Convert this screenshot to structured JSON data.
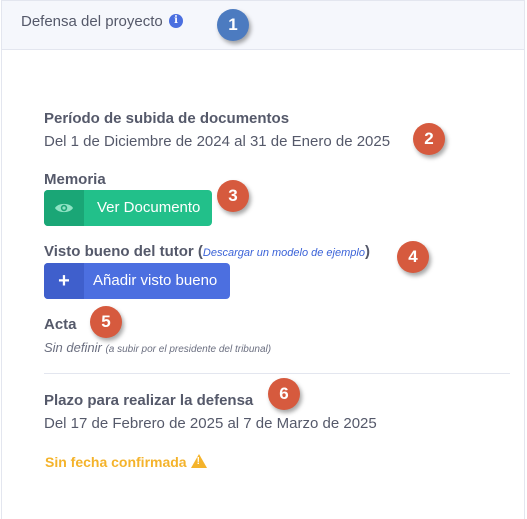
{
  "header": {
    "title": "Defensa del proyecto",
    "info_glyph": "i"
  },
  "badges": [
    "1",
    "2",
    "3",
    "4",
    "5",
    "6"
  ],
  "upload_period": {
    "label": "Período de subida de documentos",
    "value": "Del 1 de Diciembre de 2024 al 31 de Enero de 2025"
  },
  "memoria": {
    "label": "Memoria",
    "button_label": "Ver Documento",
    "button_icon": "eye-icon"
  },
  "tutor_approval": {
    "label": "Visto bueno del tutor",
    "paren_open": "(",
    "link_text": "Descargar un modelo de ejemplo",
    "paren_close": ")",
    "button_label": "Añadir visto bueno",
    "button_icon": "plus-icon",
    "button_glyph": "+"
  },
  "acta": {
    "label": "Acta",
    "value": "Sin definir",
    "note": "(a subir por el presidente del tribunal)"
  },
  "defense_deadline": {
    "label": "Plazo para realizar la defensa",
    "value": "Del 17 de Febrero de 2025 al 7 de Marzo de 2025",
    "status": "Sin fecha confirmada",
    "status_icon": "warning-icon"
  },
  "colors": {
    "badge_blue": "#4c7bc0",
    "badge_red": "#d65a3e",
    "green_button": "#22c08a",
    "blue_button": "#4c6fe0",
    "warning": "#f4b32b",
    "link": "#3b63d8"
  }
}
